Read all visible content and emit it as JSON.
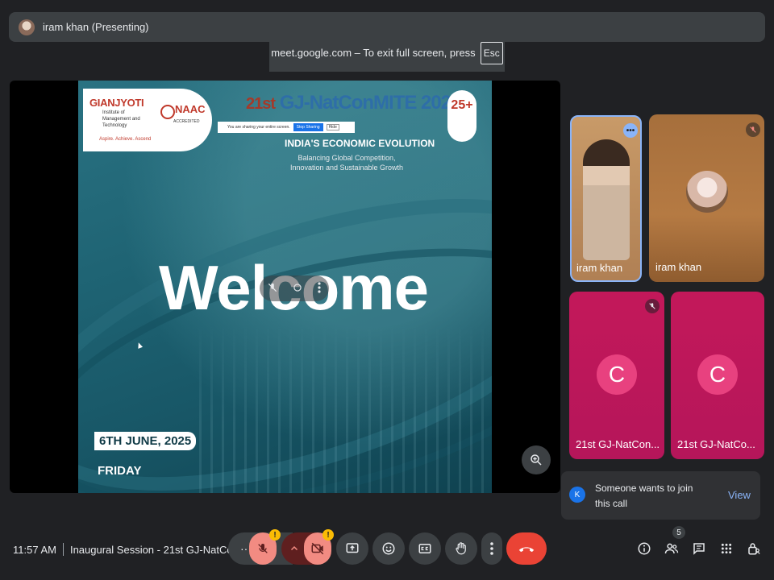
{
  "presenting_bar": {
    "label": "iram khan (Presenting)"
  },
  "fullscreen_hint": {
    "text": "meet.google.com – To exit full screen, press",
    "key": "Esc"
  },
  "slide": {
    "logo_name": "GIANJYOTI",
    "logo_sub": "Institute of Management and Technology",
    "logo_tagline": "Aspire. Achieve. Ascend",
    "naac": "NAAC",
    "naac_sub": "ACCREDITED",
    "conf_title_num": "21st",
    "conf_title": "GJ-NatConMITE 2025",
    "share_text": "You are sharing your entire screen.",
    "share_stop": "Stop Sharing",
    "share_hide": "Hide",
    "theme": "INDIA'S ECONOMIC EVOLUTION",
    "subtheme": "Balancing Global Competition, Innovation and Sustainable Growth",
    "badge": "25+",
    "welcome": "Welcome",
    "date": "6TH JUNE, 2025",
    "day": "FRIDAY"
  },
  "participants": [
    {
      "name": "iram khan",
      "muted": false,
      "type": "video"
    },
    {
      "name": "iram khan",
      "muted": true,
      "type": "avatar"
    },
    {
      "name": "21st GJ-NatCon...",
      "initial": "C",
      "muted": true
    },
    {
      "name": "21st GJ-NatCo...",
      "initial": "C",
      "muted": false
    }
  ],
  "notification": {
    "initial": "K",
    "message": "Someone wants to join this call",
    "action": "View"
  },
  "bottom": {
    "time": "11:57 AM",
    "meeting_title": "Inaugural Session - 21st GJ-NatCo...",
    "people_count": "5"
  },
  "colors": {
    "accent": "#8ab4f8",
    "end_call": "#ea4335",
    "tile_pink": "#c3185a",
    "warning": "#fbbc04"
  }
}
